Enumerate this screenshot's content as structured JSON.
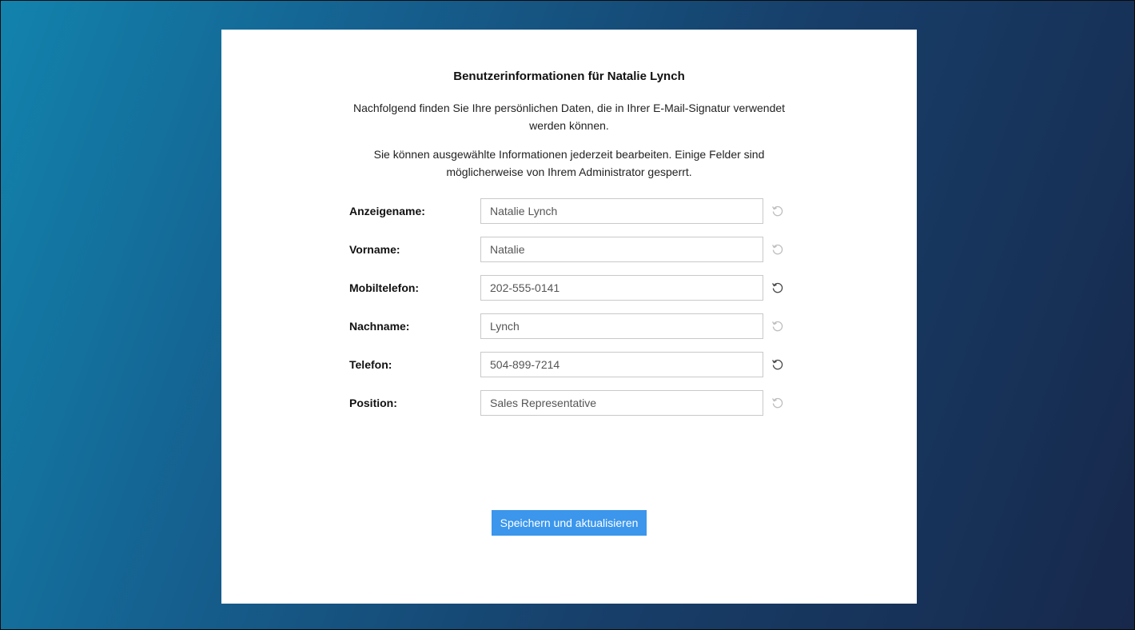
{
  "page": {
    "title": "Benutzerinformationen für Natalie Lynch",
    "intro_1": "Nachfolgend finden Sie Ihre persönlichen Daten, die in Ihrer E-Mail-Signatur verwendet werden können.",
    "intro_2": "Sie können ausgewählte Informationen jederzeit bearbeiten. Einige Felder sind möglicherweise von Ihrem Administrator gesperrt."
  },
  "fields": [
    {
      "label": "Anzeigename:",
      "value": "Natalie Lynch",
      "reset_icon": "reset-icon",
      "reset_enabled": false
    },
    {
      "label": "Vorname:",
      "value": "Natalie",
      "reset_icon": "reset-icon",
      "reset_enabled": false
    },
    {
      "label": "Mobiltelefon:",
      "value": "202-555-0141",
      "reset_icon": "reset-icon",
      "reset_enabled": true
    },
    {
      "label": "Nachname:",
      "value": "Lynch",
      "reset_icon": "reset-icon",
      "reset_enabled": false
    },
    {
      "label": "Telefon:",
      "value": "504-899-7214",
      "reset_icon": "reset-icon",
      "reset_enabled": true
    },
    {
      "label": "Position:",
      "value": "Sales Representative",
      "reset_icon": "reset-icon",
      "reset_enabled": false
    }
  ],
  "actions": {
    "save_label": "Speichern und aktualisieren"
  },
  "colors": {
    "accent": "#3b96ec",
    "background_start": "#1283ad",
    "background_end": "#17284b",
    "card": "#ffffff"
  }
}
